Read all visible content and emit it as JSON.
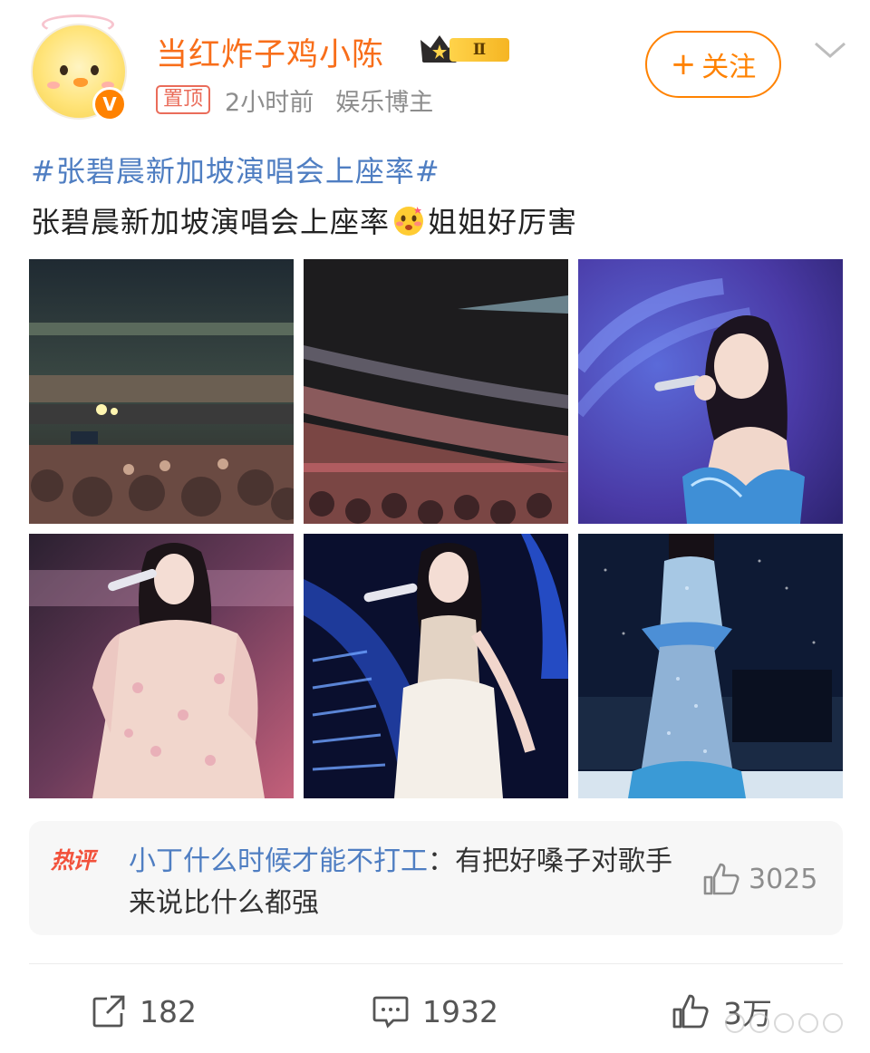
{
  "post": {
    "author": "当红炸子鸡小陈",
    "rank_badge": "Ⅱ",
    "pinned_label": "置顶",
    "time": "2小时前",
    "source": "娱乐博主",
    "follow_label": "关注",
    "follow_plus": "+",
    "topic": "#张碧晨新加坡演唱会上座率#",
    "text_before_emoji": "张碧晨新加坡演唱会上座率",
    "text_after_emoji": "姐姐好厉害"
  },
  "photos": [
    {
      "name": "arena-audience-wide",
      "kind": "crowd"
    },
    {
      "name": "arena-audience-tiers",
      "kind": "crowd"
    },
    {
      "name": "singer-blue-gown-closeup",
      "kind": "singer"
    },
    {
      "name": "singer-floral-dress",
      "kind": "singer"
    },
    {
      "name": "singer-white-gown",
      "kind": "singer"
    },
    {
      "name": "singer-sequin-mermaid-gown",
      "kind": "singer"
    }
  ],
  "hot_comment": {
    "tag": "热评",
    "nickname": "小丁什么时候才能不打工",
    "separator": "：",
    "content": "有把好嗓子对歌手来说比什么都强",
    "likes": "3025"
  },
  "actions": {
    "reposts": "182",
    "comments": "1932",
    "likes": "3万"
  },
  "colors": {
    "brand_orange": "#ff8200",
    "name_orange": "#f86e1a",
    "link_blue": "#4f7ec2",
    "hot_red": "#f2513b"
  },
  "icons": [
    "verified-v-icon",
    "crown-icon",
    "chevron-down-icon",
    "blush-emoji-icon",
    "thumb-up-icon",
    "repost-icon",
    "comment-icon"
  ]
}
